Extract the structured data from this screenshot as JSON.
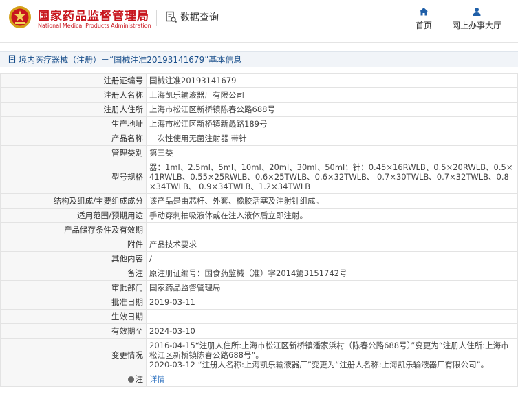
{
  "header": {
    "site_title_cn": "国家药品监督管理局",
    "site_title_en": "National Medical Products Administration",
    "query_label": "数据查询",
    "nav": {
      "home": "首页",
      "online_hall": "网上办事大厅"
    }
  },
  "breadcrumb": "境内医疗器械（注册）－“国械注准20193141679”基本信息",
  "fields": {
    "reg_no_label": "注册证编号",
    "reg_no": "国械注准20193141679",
    "registrant_label": "注册人名称",
    "registrant": "上海凯乐输液器厂有限公司",
    "address_label": "注册人住所",
    "address": "上海市松江区新桥镇陈春公路688号",
    "prod_addr_label": "生产地址",
    "prod_addr": "上海市松江区新桥镇新蠡路189号",
    "product_label": "产品名称",
    "product": "一次性使用无菌注射器 带针",
    "category_label": "管理类别",
    "category": "第三类",
    "spec_label": "型号规格",
    "spec": "器：1ml、2.5ml、5ml、10ml、20ml、30ml、50ml；针：0.45×16RWLB、0.5×20RWLB、0.5×41RWLB、0.55×25RWLB、0.6×25TWLB、0.6×32TWLB、 0.7×30TWLB、0.7×32TWLB、0.8×34TWLB、 0.9×34TWLB、1.2×34TWLB",
    "structure_label": "结构及组成/主要组成成分",
    "structure": "该产品是由芯杆、外套、橡胶活塞及注射针组成。",
    "scope_label": "适用范围/预期用途",
    "scope": "手动穿刺抽吸液体或在注入液体后立即注射。",
    "storage_label": "产品储存条件及有效期",
    "storage": "",
    "attach_label": "附件",
    "attach": "产品技术要求",
    "other_label": "其他内容",
    "other": "/",
    "remark_label": "备注",
    "remark": "原注册证编号：国食药监械（准）字2014第3151742号",
    "approver_label": "审批部门",
    "approver": "国家药品监督管理局",
    "approve_date_label": "批准日期",
    "approve_date": "2019-03-11",
    "effective_date_label": "生效日期",
    "effective_date": "",
    "valid_until_label": "有效期至",
    "valid_until": "2024-03-10",
    "change_label": "变更情况",
    "change_1": "2016-04-15“注册人住所:上海市松江区新桥镇潘家浜村（陈春公路688号）”变更为“注册人住所:上海市松江区新桥镇陈春公路688号”。",
    "change_2": "2020-03-12 “注册人名称:上海凯乐输液器厂”变更为“注册人名称:上海凯乐输液器厂有限公司”。",
    "note_label": "注",
    "note_link": "详情"
  }
}
